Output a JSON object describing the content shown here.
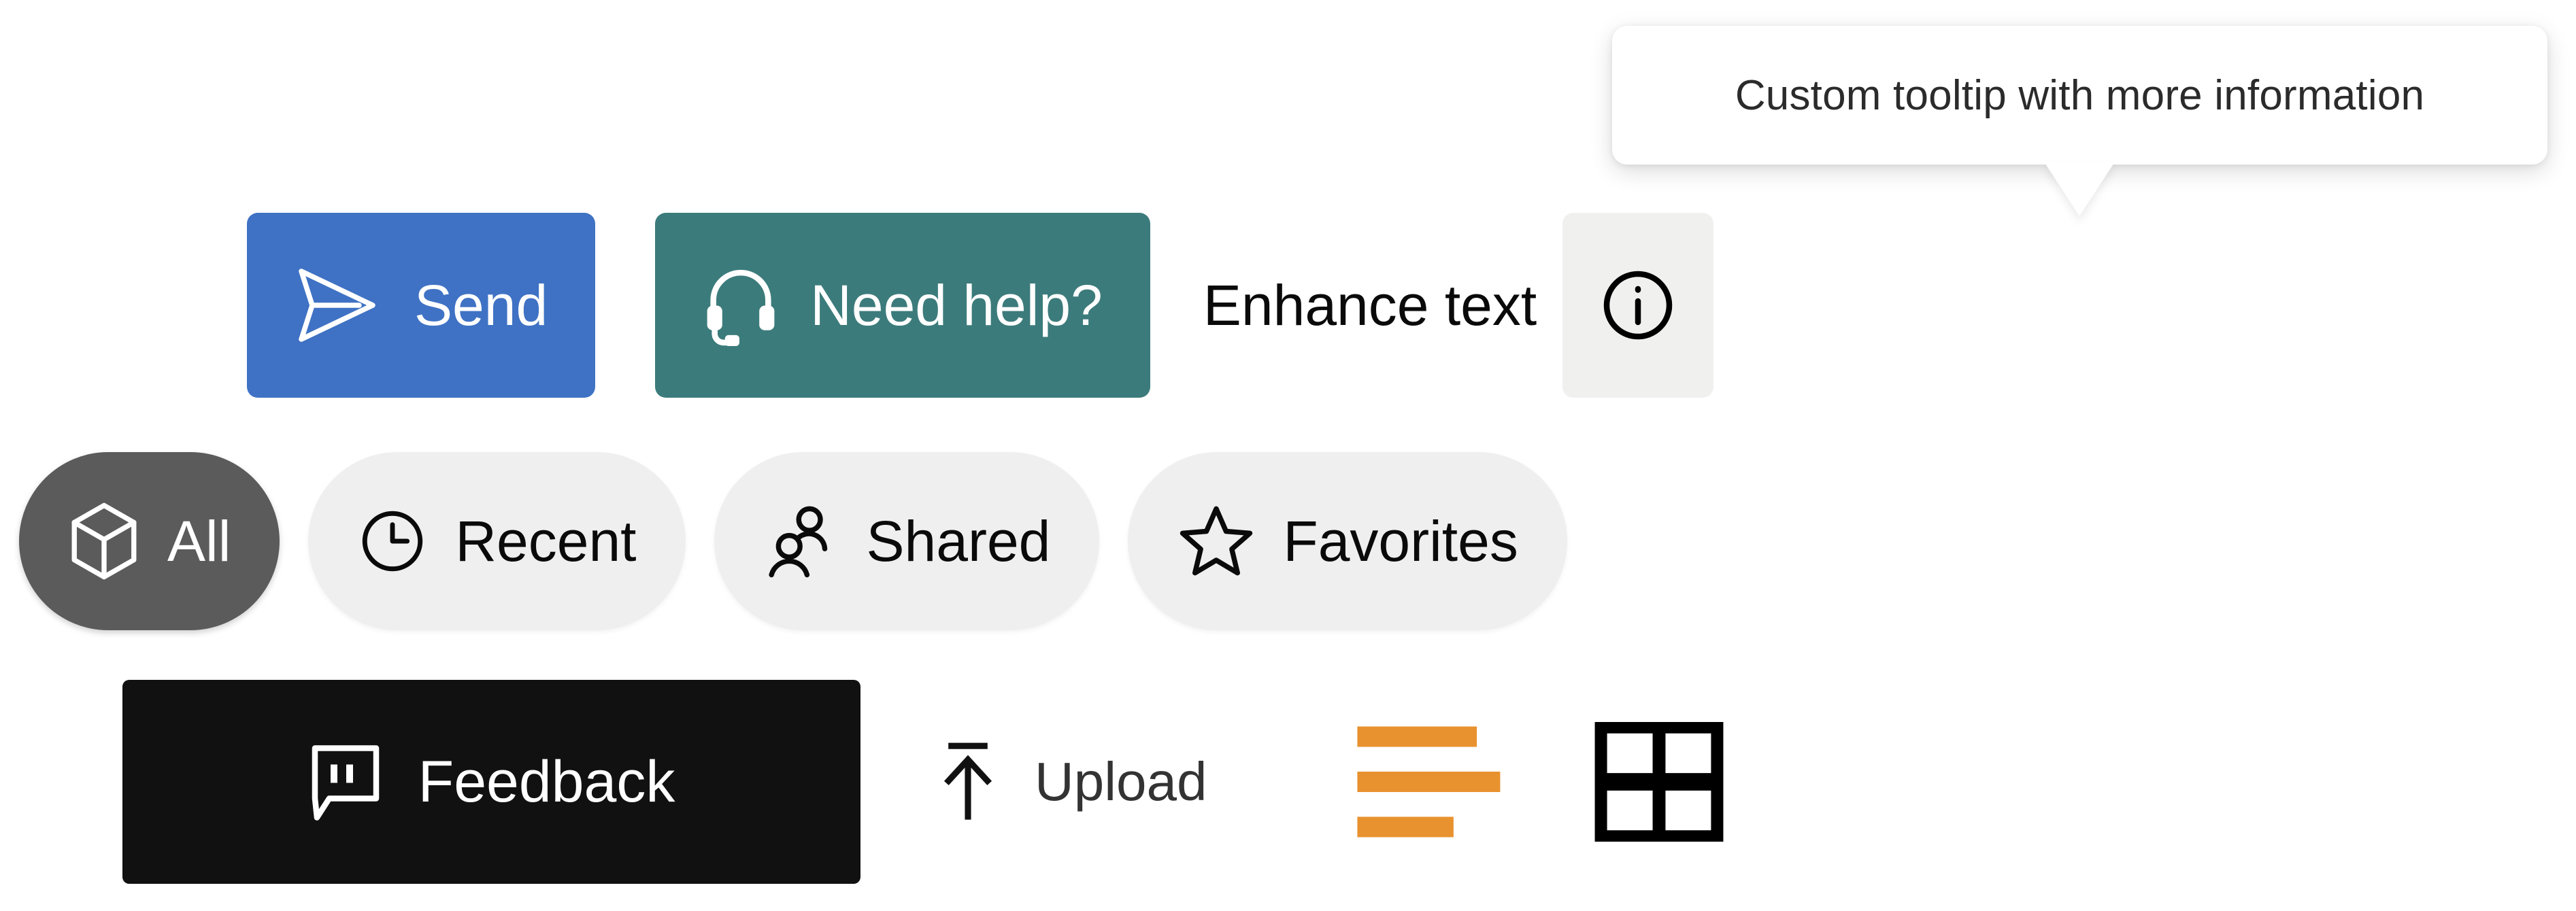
{
  "tooltip": {
    "text": "Custom tooltip with more information",
    "background": "#ffffff",
    "text_color": "#2b2b2b"
  },
  "primary_row": {
    "send": {
      "label": "Send",
      "icon": "send-icon",
      "background": "#3f72c4",
      "text_color": "#ffffff"
    },
    "help": {
      "label": "Need help?",
      "icon": "headset-icon",
      "background": "#3c7b7b",
      "text_color": "#ffffff"
    },
    "enhance": {
      "label": "Enhance text",
      "text_color": "#0a0a0a"
    },
    "info": {
      "icon": "info-circle-icon",
      "background": "#f0f0ee",
      "icon_color": "#000000"
    }
  },
  "filter_pills": [
    {
      "label": "All",
      "icon": "cube-icon",
      "active": true,
      "background": "#5b5b5b",
      "text_color": "#ffffff"
    },
    {
      "label": "Recent",
      "icon": "clock-icon",
      "active": false,
      "background": "#efefef",
      "text_color": "#0a0a0a"
    },
    {
      "label": "Shared",
      "icon": "people-icon",
      "active": false,
      "background": "#efefef",
      "text_color": "#0a0a0a"
    },
    {
      "label": "Favorites",
      "icon": "star-icon",
      "active": false,
      "background": "#efefef",
      "text_color": "#0a0a0a"
    }
  ],
  "bottom_row": {
    "feedback": {
      "label": "Feedback",
      "icon": "speech-bubble-quote-icon",
      "background": "#111111",
      "text_color": "#ffffff"
    },
    "upload": {
      "label": "Upload",
      "icon": "arrow-up-to-line-icon",
      "text_color": "#333333"
    },
    "list_view": {
      "icon": "list-lines-icon",
      "color": "#e8922f"
    },
    "grid_view": {
      "icon": "grid-four-squares-icon",
      "color": "#000000"
    }
  }
}
